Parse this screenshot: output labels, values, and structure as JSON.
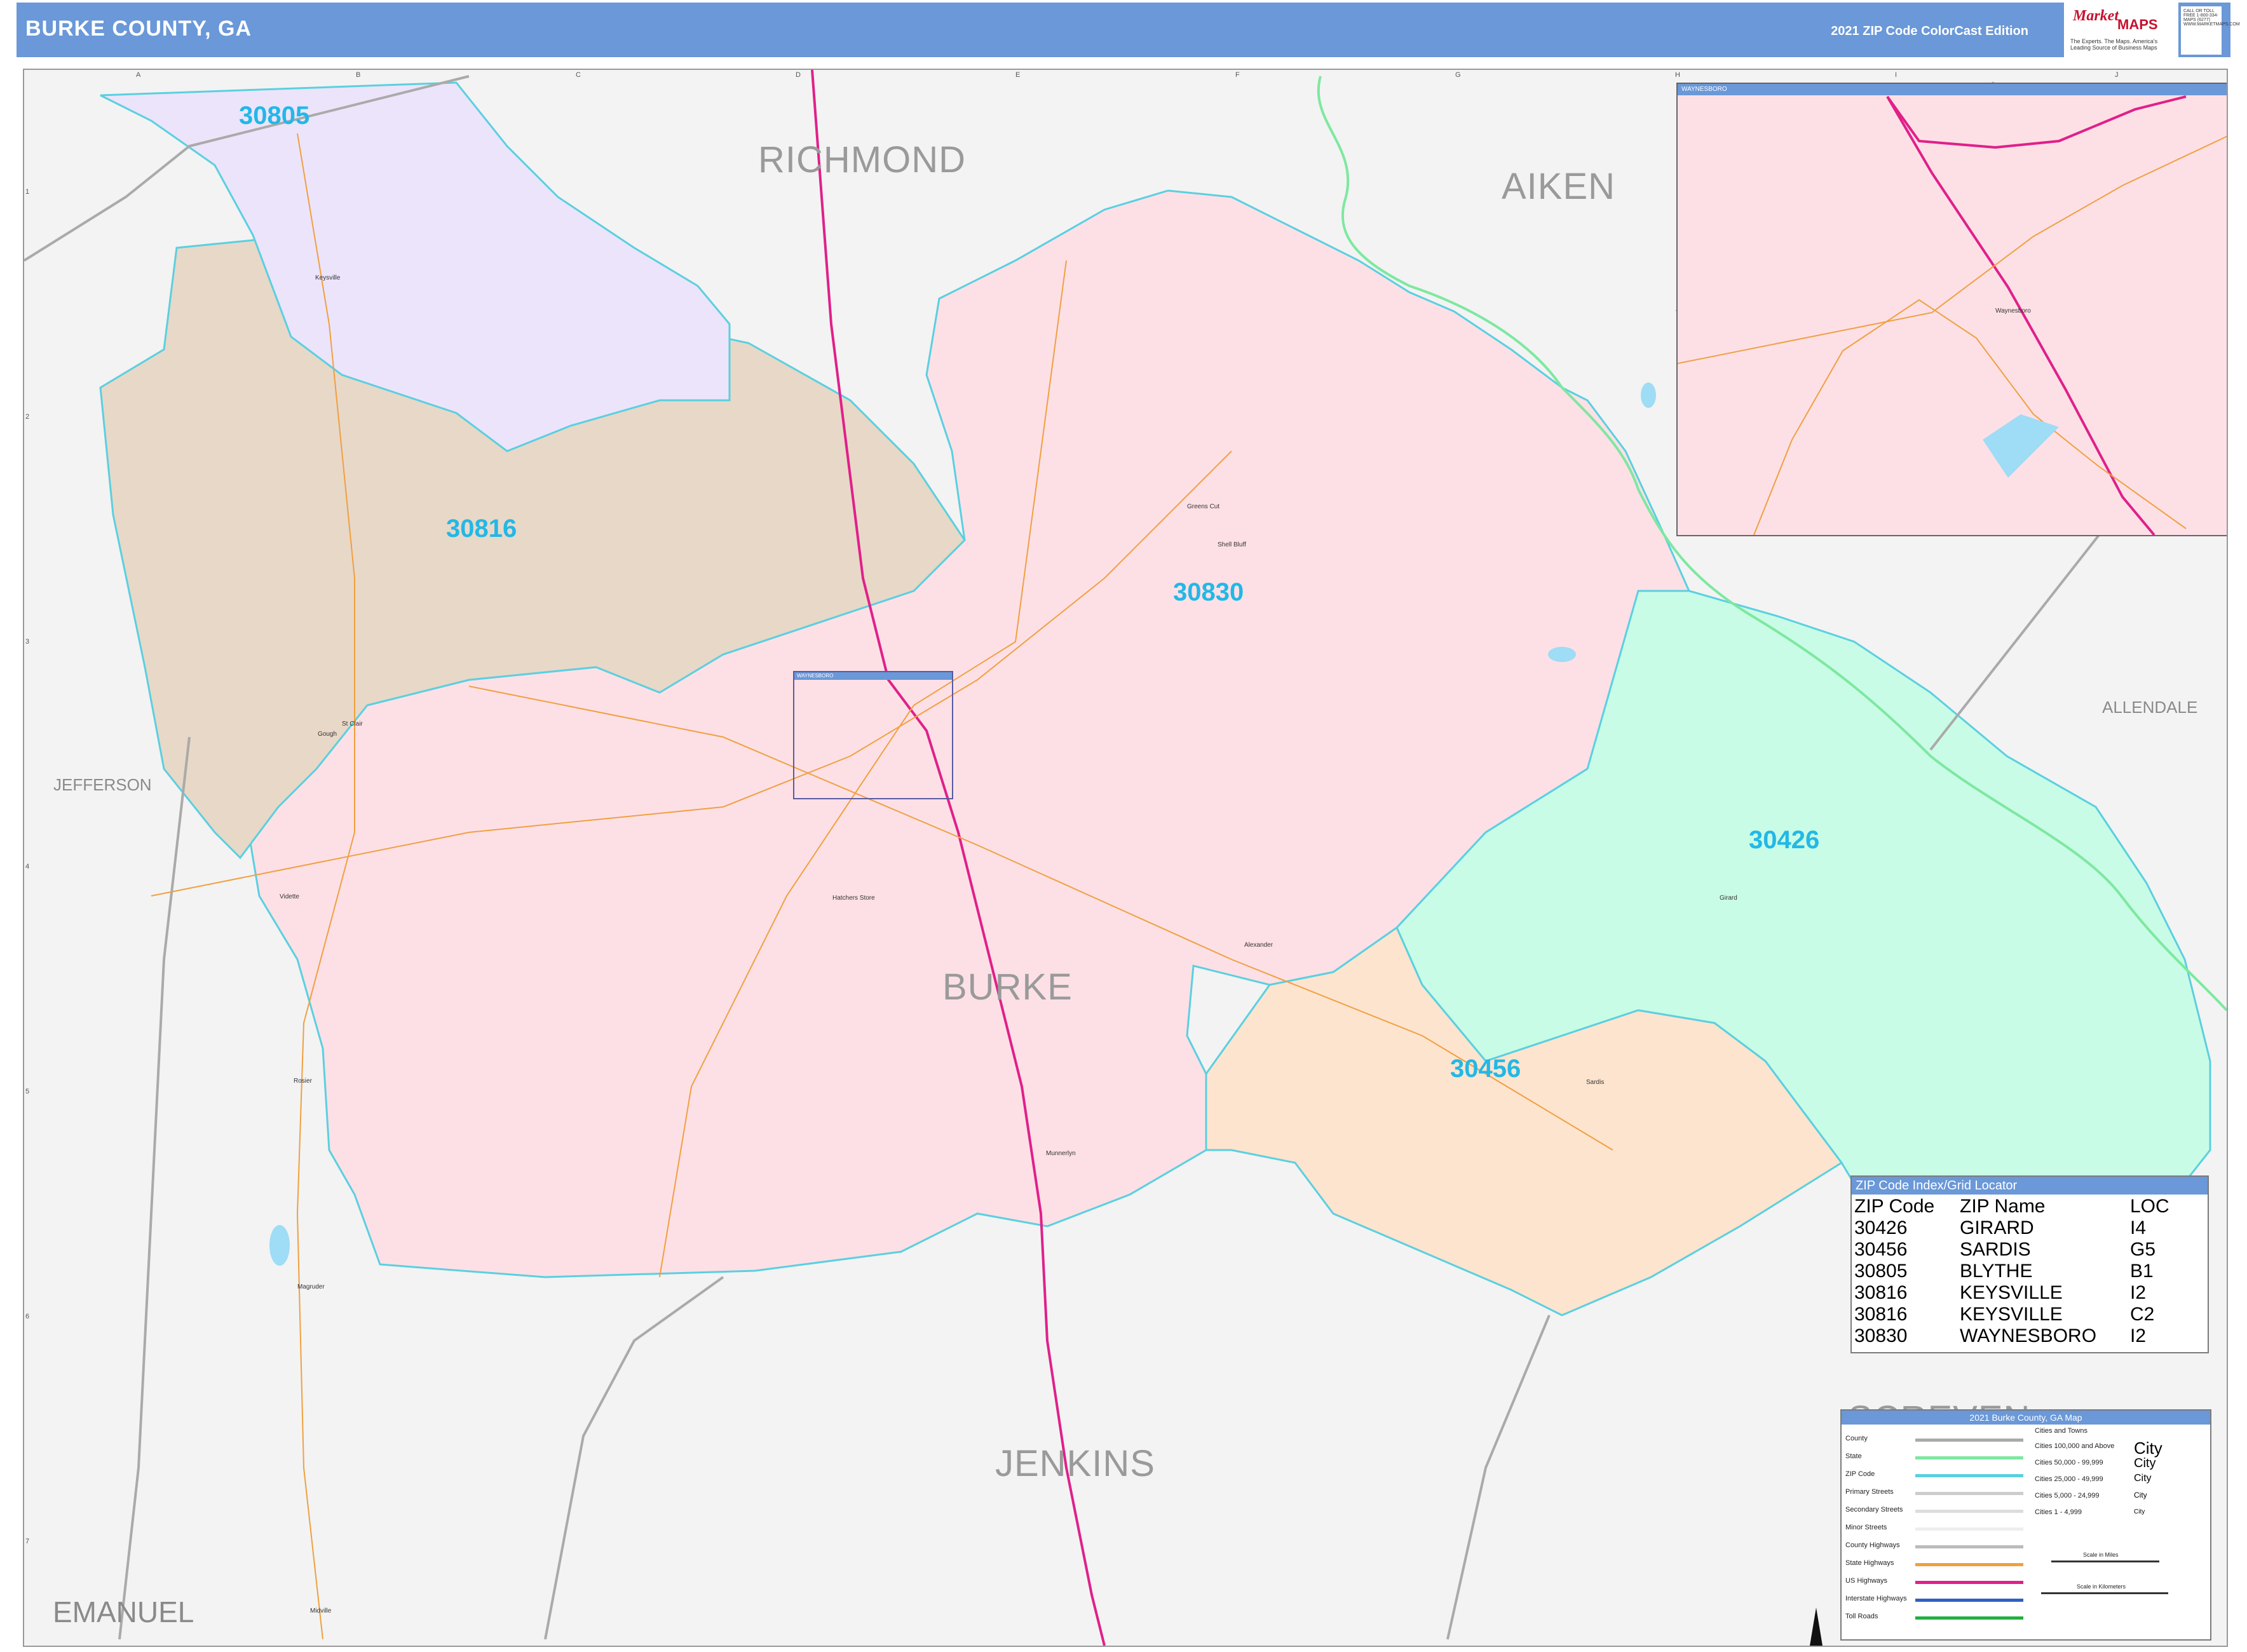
{
  "header": {
    "title": "BURKE COUNTY, GA",
    "edition": "2021 ZIP Code ColorCast Edition",
    "logo_brand": "Market",
    "logo_maps": "MAPS",
    "logo_tagline": "The Experts. The Maps. America's Leading Source of Business Maps",
    "contact": "CALL OR TOLL FREE 1-800-334-MAPS (6277) WWW.MARKETMAPS.COM"
  },
  "colors": {
    "header_blue": "#6a98d8",
    "zip_30830": "#fde0e6",
    "zip_30816": "#e8d8c8",
    "zip_30805": "#ece4fb",
    "zip_30426": "#c9fce6",
    "zip_30456": "#fde4cf",
    "zip_label": "#22b8e6",
    "outside": "#f3f3f3"
  },
  "grid": {
    "columns": [
      "A",
      "B",
      "C",
      "D",
      "E",
      "F",
      "G",
      "H",
      "I",
      "J"
    ],
    "rows": [
      "1",
      "2",
      "3",
      "4",
      "5",
      "6",
      "7"
    ]
  },
  "counties": {
    "richmond": "RICHMOND",
    "aiken": "AIKEN",
    "jefferson": "JEFFERSON",
    "allendale": "ALLENDALE",
    "burke": "BURKE",
    "jenkins": "JENKINS",
    "emanuel": "EMANUEL",
    "screven": "SCREVEN"
  },
  "zip_labels": {
    "z30805": "30805",
    "z30816": "30816",
    "z30830": "30830",
    "z30426": "30426",
    "z30456": "30456"
  },
  "towns": {
    "keysville": "Keysville",
    "greens_cut": "Greens Cut",
    "shell_bluff": "Shell Bluff",
    "st_clair": "St Clair",
    "gough": "Gough",
    "vidette": "Vidette",
    "hatchers_store": "Hatchers Store",
    "alexander": "Alexander",
    "girard": "Girard",
    "sardis": "Sardis",
    "munnerlyn": "Munnerlyn",
    "rosier": "Rosier",
    "magruder": "Magruder",
    "midville": "Midville"
  },
  "locator": {
    "label": "WAYNESBORO"
  },
  "inset": {
    "title": "WAYNESBORO",
    "town": "Waynesboro"
  },
  "zip_index": {
    "title": "ZIP Code Index/Grid Locator",
    "headers": [
      "ZIP Code",
      "ZIP Name",
      "LOC"
    ],
    "rows": [
      [
        "30426",
        "GIRARD",
        "I4"
      ],
      [
        "30456",
        "SARDIS",
        "G5"
      ],
      [
        "30805",
        "BLYTHE",
        "B1"
      ],
      [
        "30816",
        "KEYSVILLE",
        "I2"
      ],
      [
        "30816",
        "KEYSVILLE",
        "C2"
      ],
      [
        "30830",
        "WAYNESBORO",
        "I2"
      ]
    ]
  },
  "legend": {
    "title": "2021 Burke County, GA Map",
    "items": [
      {
        "label": "County",
        "color": "#aaaaaa"
      },
      {
        "label": "State",
        "color": "#7de8a0"
      },
      {
        "label": "ZIP Code",
        "color": "#5ad0e0"
      },
      {
        "label": "Primary Streets",
        "color": "#cccccc"
      },
      {
        "label": "Secondary Streets",
        "color": "#dddddd"
      },
      {
        "label": "Minor Streets",
        "color": "#eeeeee"
      },
      {
        "label": "County Highways",
        "color": "#bbbbbb"
      },
      {
        "label": "State Highways",
        "color": "#f0a040"
      },
      {
        "label": "US Highways",
        "color": "#e0208a"
      },
      {
        "label": "Interstate Highways",
        "color": "#3060c0"
      },
      {
        "label": "Toll Roads",
        "color": "#20b040"
      }
    ],
    "cities_title": "Cities and Towns",
    "cities": [
      {
        "label": "Cities 100,000 and Above",
        "sample": "City"
      },
      {
        "label": "Cities 50,000 - 99,999",
        "sample": "City"
      },
      {
        "label": "Cities 25,000 - 49,999",
        "sample": "City"
      },
      {
        "label": "Cities 5,000 - 24,999",
        "sample": "City"
      },
      {
        "label": "Cities 1 - 4,999",
        "sample": "City"
      }
    ],
    "scale_miles": "Scale in Miles",
    "scale_km": "Scale in Kilometers"
  }
}
